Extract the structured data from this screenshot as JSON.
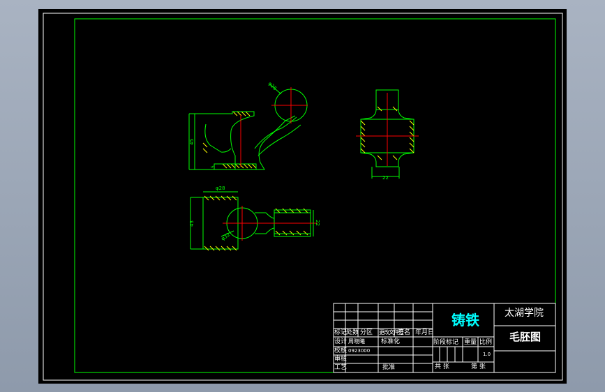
{
  "colors": {
    "background": "#000000",
    "frame": "#ffffff",
    "geometry": "#00ff00",
    "centerline": "#ff0000",
    "hatch": "#ffff00",
    "dimension": "#00ff00",
    "text_cyan": "#00ffff",
    "text_white": "#ffffff",
    "window_chrome": "#9aa5b5"
  },
  "dimensions": {
    "front_ball_dia": "φ25",
    "front_height": "45",
    "front_small": "5",
    "side_width": "22",
    "top_width": "φ28",
    "top_height": "43",
    "top_ball_dia": "φ32",
    "top_right_height": "22"
  },
  "title_block": {
    "part_name": "铸铁",
    "school": "太湖学院",
    "drawing_name": "毛胚图",
    "row_labels": {
      "mark": "标记",
      "count": "处数",
      "zone": "分区",
      "change_doc": "更改文件号",
      "sign": "签名",
      "date": "年月日",
      "design": "设计",
      "designer": "周晓曦",
      "standardize": "标准化",
      "proofread": "校核",
      "checker": "0923000",
      "review": "审核",
      "process": "工艺",
      "approve": "批准"
    },
    "stage_labels": {
      "stage": "阶段标记",
      "weight": "重量",
      "scale": "比例",
      "scale_value": "1.0",
      "total": "共  张",
      "sheet": "第  张"
    }
  }
}
